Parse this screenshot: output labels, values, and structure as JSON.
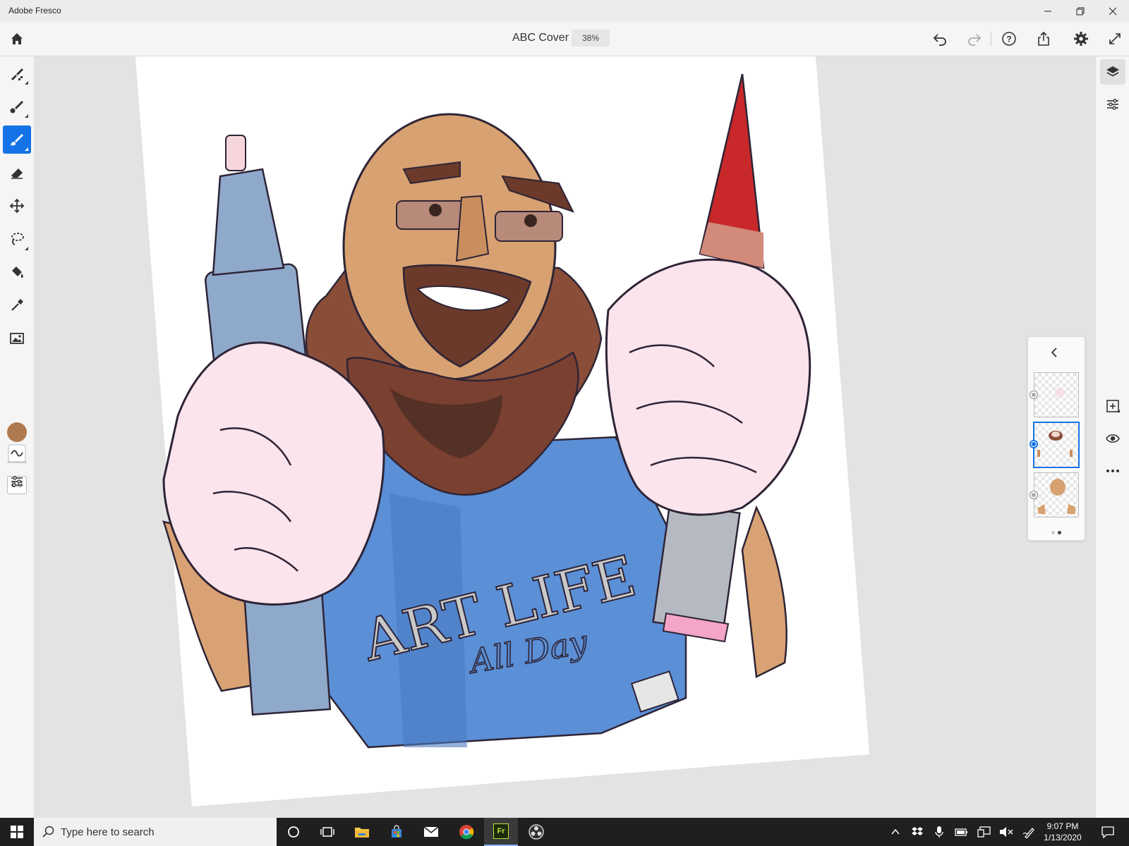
{
  "window": {
    "title": "Adobe Fresco",
    "controls": [
      "minimize-icon",
      "restore-icon",
      "close-icon"
    ]
  },
  "appbar": {
    "document_title": "ABC Cover",
    "zoom": "38%",
    "actions": [
      "undo-icon",
      "redo-icon",
      "help-icon",
      "share-icon",
      "gear-icon",
      "fullscreen-icon"
    ]
  },
  "toolbar": {
    "tools": [
      "pixel-brush-icon",
      "live-brush-icon",
      "vector-brush-icon",
      "eraser-icon",
      "move-transform-icon",
      "lasso-icon",
      "fill-icon",
      "eyedropper-icon",
      "place-image-icon"
    ],
    "active_tool": "vector-brush-icon",
    "current_color": "#b07a50",
    "brush_size": "8.0"
  },
  "right_panel": {
    "icons": [
      "layers-icon",
      "layer-properties-icon",
      "add-layer-icon",
      "visibility-icon",
      "more-icon"
    ]
  },
  "layers": {
    "collapse_icon": "chevron-left-icon",
    "items": [
      {
        "name": "layer-1",
        "selected": false
      },
      {
        "name": "layer-2",
        "selected": true
      },
      {
        "name": "layer-3",
        "selected": false
      }
    ],
    "page_indicator": 2,
    "active_page": 2
  },
  "canvas": {
    "shirt_text_main": "ART LIFE",
    "shirt_text_script": "All Day",
    "accent_color": "#1473e6"
  },
  "taskbar": {
    "search_placeholder": "Type here to search",
    "pinned": [
      "cortana-icon",
      "task-view-icon",
      "file-explorer-icon",
      "store-icon",
      "mail-icon",
      "chrome-icon",
      "fresco-icon",
      "obs-icon"
    ],
    "active_app": "fresco-icon",
    "fresco_label": "Fr",
    "time": "9:07 PM",
    "date": "1/13/2020"
  }
}
